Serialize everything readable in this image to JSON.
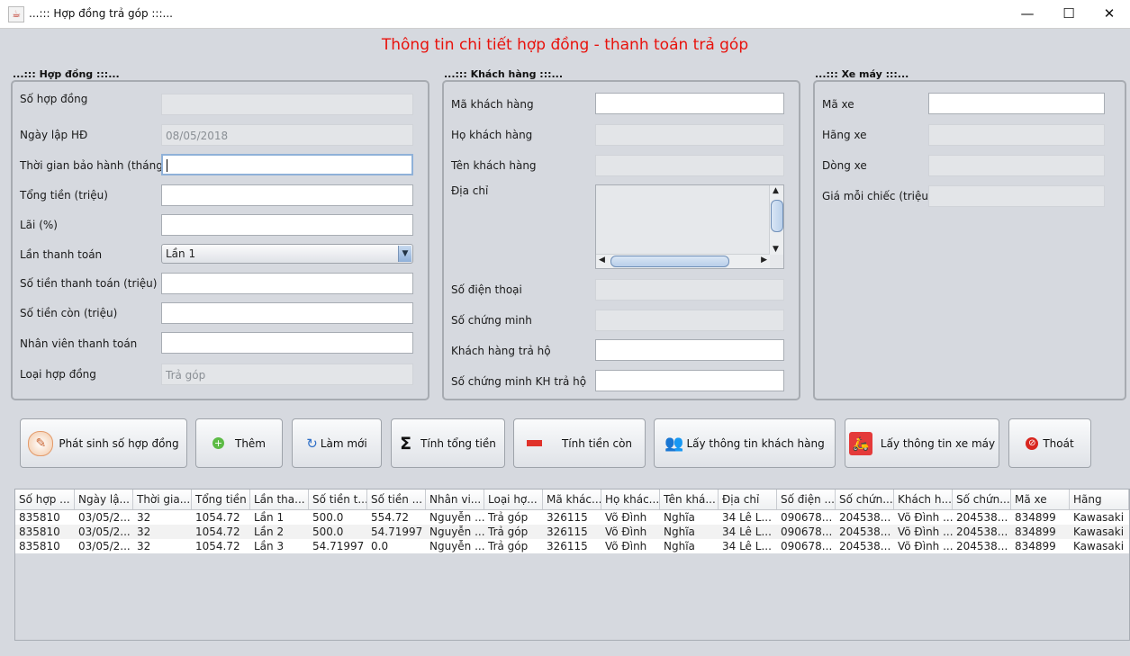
{
  "window": {
    "title": "...::: Hợp đồng trả góp :::...",
    "min": "—",
    "max": "☐",
    "close": "✕"
  },
  "main_title": "Thông tin chi tiết hợp đồng - thanh toán trả góp",
  "contract": {
    "group_title": "...::: Hợp đồng :::...",
    "so_hop_dong_label": "Số hợp đồng",
    "so_hop_dong_value": "",
    "ngay_lap_label": "Ngày lập HĐ",
    "ngay_lap_value": "08/05/2018",
    "bao_hanh_label": "Thời gian bảo hành (tháng)",
    "bao_hanh_value": "",
    "tong_tien_label": "Tổng tiền (triệu)",
    "tong_tien_value": "",
    "lai_label": "Lãi (%)",
    "lai_value": "",
    "lan_tt_label": "Lần thanh toán",
    "lan_tt_value": "Lần 1",
    "so_tien_tt_label": "Số tiền thanh toán (triệu)",
    "so_tien_tt_value": "",
    "so_tien_con_label": "Số tiền còn (triệu)",
    "so_tien_con_value": "",
    "nhan_vien_label": "Nhân viên thanh toán",
    "nhan_vien_value": "",
    "loai_hd_label": "Loại hợp đồng",
    "loai_hd_value": "Trả góp"
  },
  "customer": {
    "group_title": "...::: Khách hàng :::...",
    "ma_kh_label": "Mã khách hàng",
    "ma_kh_value": "",
    "ho_kh_label": "Họ khách hàng",
    "ho_kh_value": "",
    "ten_kh_label": "Tên khách hàng",
    "ten_kh_value": "",
    "dia_chi_label": "Địa chỉ",
    "dia_chi_value": "",
    "sdt_label": "Số điện thoại",
    "sdt_value": "",
    "cmnd_label": "Số chứng minh",
    "cmnd_value": "",
    "tra_ho_label": "Khách hàng trả hộ",
    "tra_ho_value": "",
    "cmnd_tra_ho_label": "Số chứng minh KH trả hộ",
    "cmnd_tra_ho_value": ""
  },
  "motorbike": {
    "group_title": "...::: Xe máy :::...",
    "ma_xe_label": "Mã xe",
    "ma_xe_value": "",
    "hang_xe_label": "Hãng xe",
    "hang_xe_value": "",
    "dong_xe_label": "Dòng xe",
    "dong_xe_value": "",
    "gia_label": "Giá mỗi chiếc (triệu)",
    "gia_value": ""
  },
  "buttons": {
    "phat_sinh": "Phát sinh số hợp đồng",
    "them": "Thêm",
    "lam_moi": "Làm mới",
    "tinh_tong": "Tính tổng tiền",
    "tinh_con": "Tính tiền còn",
    "lay_kh": "Lấy thông tin khách hàng",
    "lay_xe": "Lấy thông tin xe máy",
    "thoat": "Thoát"
  },
  "table": {
    "columns": [
      "Số hợp ...",
      "Ngày lậ...",
      "Thời gia...",
      "Tổng tiền",
      "Lần tha...",
      "Số tiền t...",
      "Số tiền ...",
      "Nhân vi...",
      "Loại hợ...",
      "Mã khác...",
      "Họ khác...",
      "Tên khá...",
      "Địa chỉ",
      "Số điện ...",
      "Số chứn...",
      "Khách h...",
      "Số chứn...",
      "Mã xe",
      "Hãng"
    ],
    "rows": [
      [
        "835810",
        "03/05/2...",
        "32",
        "1054.72",
        "Lần 1",
        "500.0",
        "554.72",
        "Nguyễn ...",
        "Trả góp",
        "326115",
        "Võ Đình",
        "Nghĩa",
        "34 Lê L...",
        "090678...",
        "204538...",
        "Võ Đình ...",
        "204538...",
        "834899",
        "Kawasaki"
      ],
      [
        "835810",
        "03/05/2...",
        "32",
        "1054.72",
        "Lần 2",
        "500.0",
        "54.71997",
        "Nguyễn ...",
        "Trả góp",
        "326115",
        "Võ Đình",
        "Nghĩa",
        "34 Lê L...",
        "090678...",
        "204538...",
        "Võ Đình ...",
        "204538...",
        "834899",
        "Kawasaki"
      ],
      [
        "835810",
        "03/05/2...",
        "32",
        "1054.72",
        "Lần 3",
        "54.71997",
        "0.0",
        "Nguyễn ...",
        "Trả góp",
        "326115",
        "Võ Đình",
        "Nghĩa",
        "34 Lê L...",
        "090678...",
        "204538...",
        "Võ Đình ...",
        "204538...",
        "834899",
        "Kawasaki"
      ]
    ]
  }
}
